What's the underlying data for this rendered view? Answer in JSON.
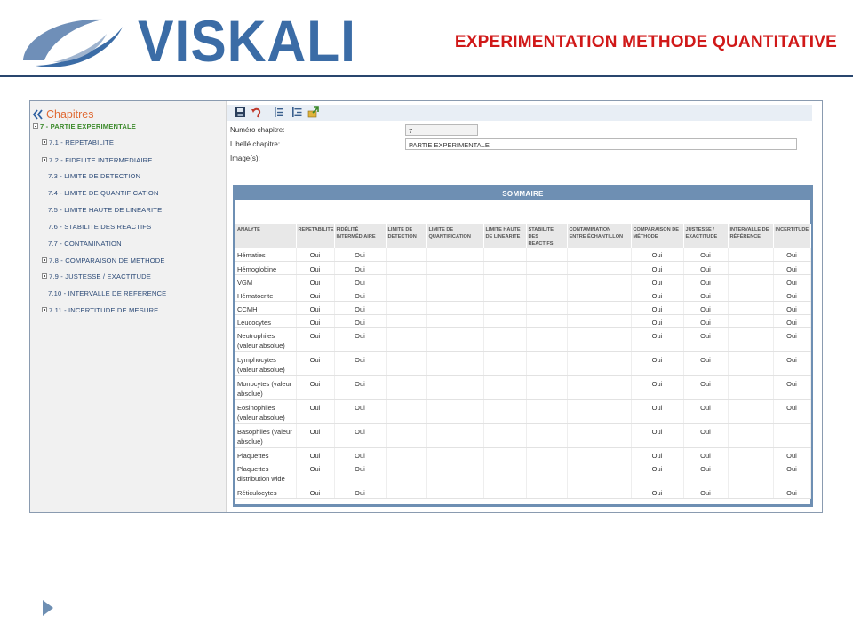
{
  "slide": {
    "logo_text": "VISKALI",
    "title": "EXPERIMENTATION METHODE QUANTITATIVE"
  },
  "sidebar": {
    "title": "Chapitres",
    "tree": [
      {
        "label": "7 - PARTIE EXPERIMENTALE",
        "expander": "minus",
        "level": 0,
        "selected": true
      },
      {
        "label": "7.1 - REPETABILITE",
        "expander": "plus",
        "level": 1
      },
      {
        "label": "7.2 - FIDELITE INTERMEDIAIRE",
        "expander": "plus",
        "level": 1
      },
      {
        "label": "7.3 - LIMITE DE DETECTION",
        "expander": "none",
        "level": 1
      },
      {
        "label": "7.4 - LIMITE DE QUANTIFICATION",
        "expander": "none",
        "level": 1
      },
      {
        "label": "7.5 - LIMITE HAUTE DE LINEARITE",
        "expander": "none",
        "level": 1
      },
      {
        "label": "7.6 - STABILITE DES REACTIFS",
        "expander": "none",
        "level": 1
      },
      {
        "label": "7.7 - CONTAMINATION",
        "expander": "none",
        "level": 1
      },
      {
        "label": "7.8 - COMPARAISON DE METHODE",
        "expander": "plus",
        "level": 1
      },
      {
        "label": "7.9 - JUSTESSE / EXACTITUDE",
        "expander": "plus",
        "level": 1
      },
      {
        "label": "7.10 - INTERVALLE DE REFERENCE",
        "expander": "none",
        "level": 1
      },
      {
        "label": "7.11 - INCERTITUDE DE MESURE",
        "expander": "plus",
        "level": 1
      }
    ]
  },
  "toolbar": {
    "icons": [
      "save-icon",
      "undo-icon",
      "list-icon",
      "indent-list-icon",
      "export-icon"
    ]
  },
  "form": {
    "number_label": "Numéro chapitre:",
    "number_value": "7",
    "label_label": "Libellé chapitre:",
    "label_value": "PARTIE EXPERIMENTALE",
    "images_label": "Image(s):"
  },
  "summary": {
    "title": "SOMMAIRE",
    "columns": [
      "ANALYTE",
      "REPETABILITE",
      "FIDÉLITÉ INTERMÉDIAIRE",
      "LIMITE DE DETECTION",
      "LIMITE DE QUANTIFICATION",
      "LIMITE HAUTE DE LINEARITE",
      "STABILITE DES RÉACTIFS",
      "CONTAMINATION ENTRE ÉCHANTILLON",
      "COMPARAISON DE MÉTHODE",
      "JUSTESSE / EXACTITUDE",
      "INTERVALLE DE RÉFÉRENCE",
      "INCERTITUDE"
    ],
    "rows": [
      {
        "analyte": "Hématies",
        "values": [
          "Oui",
          "Oui",
          "",
          "",
          "",
          "",
          "",
          "Oui",
          "Oui",
          "",
          "Oui"
        ]
      },
      {
        "analyte": "Hémoglobine",
        "values": [
          "Oui",
          "Oui",
          "",
          "",
          "",
          "",
          "",
          "Oui",
          "Oui",
          "",
          "Oui"
        ]
      },
      {
        "analyte": "VGM",
        "values": [
          "Oui",
          "Oui",
          "",
          "",
          "",
          "",
          "",
          "Oui",
          "Oui",
          "",
          "Oui"
        ]
      },
      {
        "analyte": "Hématocrite",
        "values": [
          "Oui",
          "Oui",
          "",
          "",
          "",
          "",
          "",
          "Oui",
          "Oui",
          "",
          "Oui"
        ]
      },
      {
        "analyte": "CCMH",
        "values": [
          "Oui",
          "Oui",
          "",
          "",
          "",
          "",
          "",
          "Oui",
          "Oui",
          "",
          "Oui"
        ]
      },
      {
        "analyte": "Leucocytes",
        "values": [
          "Oui",
          "Oui",
          "",
          "",
          "",
          "",
          "",
          "Oui",
          "Oui",
          "",
          "Oui"
        ]
      },
      {
        "analyte": "Neutrophiles (valeur absolue)",
        "values": [
          "Oui",
          "Oui",
          "",
          "",
          "",
          "",
          "",
          "Oui",
          "Oui",
          "",
          "Oui"
        ]
      },
      {
        "analyte": "Lymphocytes (valeur absolue)",
        "values": [
          "Oui",
          "Oui",
          "",
          "",
          "",
          "",
          "",
          "Oui",
          "Oui",
          "",
          "Oui"
        ]
      },
      {
        "analyte": "Monocytes (valeur absolue)",
        "values": [
          "Oui",
          "Oui",
          "",
          "",
          "",
          "",
          "",
          "Oui",
          "Oui",
          "",
          "Oui"
        ]
      },
      {
        "analyte": "Eosinophiles (valeur absolue)",
        "values": [
          "Oui",
          "Oui",
          "",
          "",
          "",
          "",
          "",
          "Oui",
          "Oui",
          "",
          "Oui"
        ]
      },
      {
        "analyte": "Basophiles (valeur absolue)",
        "values": [
          "Oui",
          "Oui",
          "",
          "",
          "",
          "",
          "",
          "Oui",
          "Oui",
          "",
          ""
        ]
      },
      {
        "analyte": "Plaquettes",
        "values": [
          "Oui",
          "Oui",
          "",
          "",
          "",
          "",
          "",
          "Oui",
          "Oui",
          "",
          "Oui"
        ]
      },
      {
        "analyte": "Plaquettes distribution wide",
        "values": [
          "Oui",
          "Oui",
          "",
          "",
          "",
          "",
          "",
          "Oui",
          "Oui",
          "",
          "Oui"
        ]
      },
      {
        "analyte": "Réticulocytes",
        "values": [
          "Oui",
          "Oui",
          "",
          "",
          "",
          "",
          "",
          "Oui",
          "Oui",
          "",
          "Oui"
        ]
      }
    ]
  },
  "colors": {
    "logo_blue": "#3b6ca6",
    "title_red": "#d01818",
    "sidebar_title_orange": "#e06a34",
    "tree_root_green": "#3c8a2b",
    "panel_blue": "#6e8fb3"
  }
}
